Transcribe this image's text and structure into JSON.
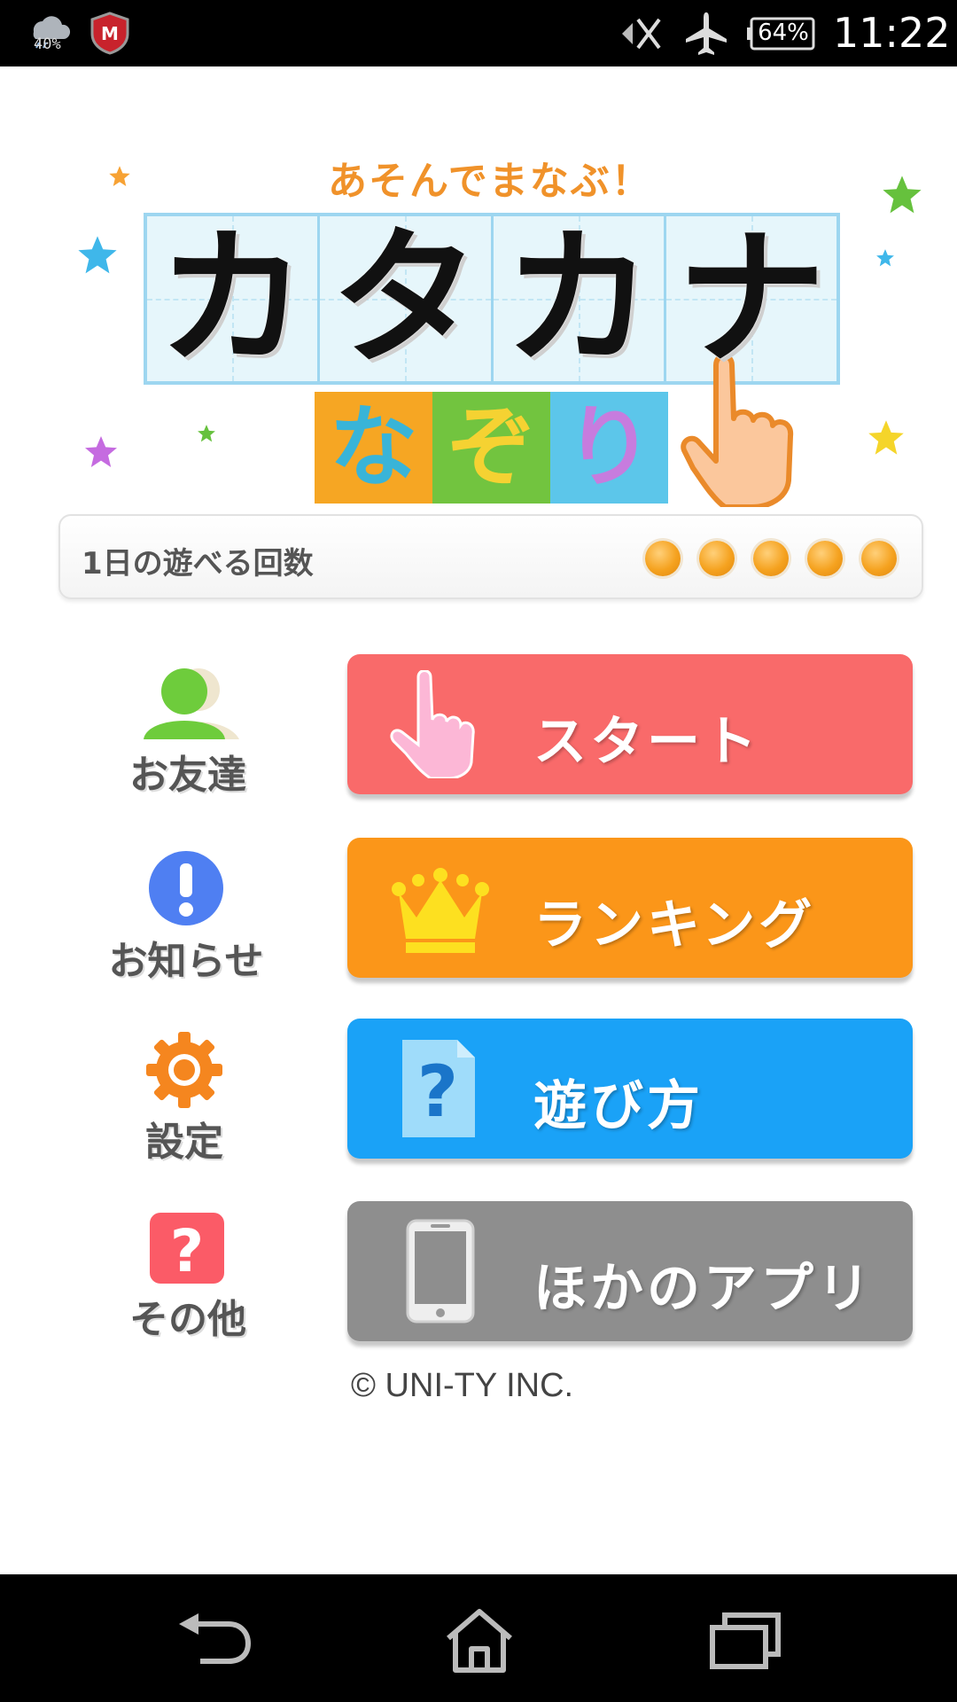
{
  "status_bar": {
    "weather_percent": "40%",
    "battery_percent": "64%",
    "time": "11:22",
    "icons": [
      "weather-cloud-icon",
      "security-shield-icon",
      "no-signal-icon",
      "airplane-mode-icon",
      "battery-icon"
    ]
  },
  "logo": {
    "subtitle": "あそんでまなぶ！",
    "title_chars": [
      "カ",
      "タ",
      "カ",
      "ナ"
    ],
    "nazori_chars": [
      "な",
      "ぞ",
      "り"
    ],
    "colors": {
      "subtitle": "#f0922a",
      "nazori_bg": [
        "#f6a623",
        "#72c43f",
        "#5cc6ea"
      ]
    }
  },
  "plays_panel": {
    "label": "1日の遊べる回数",
    "remaining": 5,
    "max": 5
  },
  "side_menu": {
    "friends": {
      "label": "お友達",
      "icon": "friends-icon"
    },
    "news": {
      "label": "お知らせ",
      "icon": "exclamation-icon"
    },
    "settings": {
      "label": "設定",
      "icon": "gear-icon"
    },
    "other": {
      "label": "その他",
      "icon": "question-icon"
    }
  },
  "buttons": {
    "start": {
      "label": "スタート",
      "icon": "pointing-hand-icon",
      "color": "#f96a6a"
    },
    "ranking": {
      "label": "ランキング",
      "icon": "crown-icon",
      "color": "#fb9619"
    },
    "howto": {
      "label": "遊び方",
      "icon": "help-document-icon",
      "color": "#1aa2f7"
    },
    "other_apps": {
      "label": "ほかのアプリ",
      "icon": "smartphone-icon",
      "color": "#8e8e8e"
    }
  },
  "copyright": "© UNI-TY INC.",
  "nav_bar": {
    "icons": [
      "back-icon",
      "home-icon",
      "recent-apps-icon"
    ]
  }
}
